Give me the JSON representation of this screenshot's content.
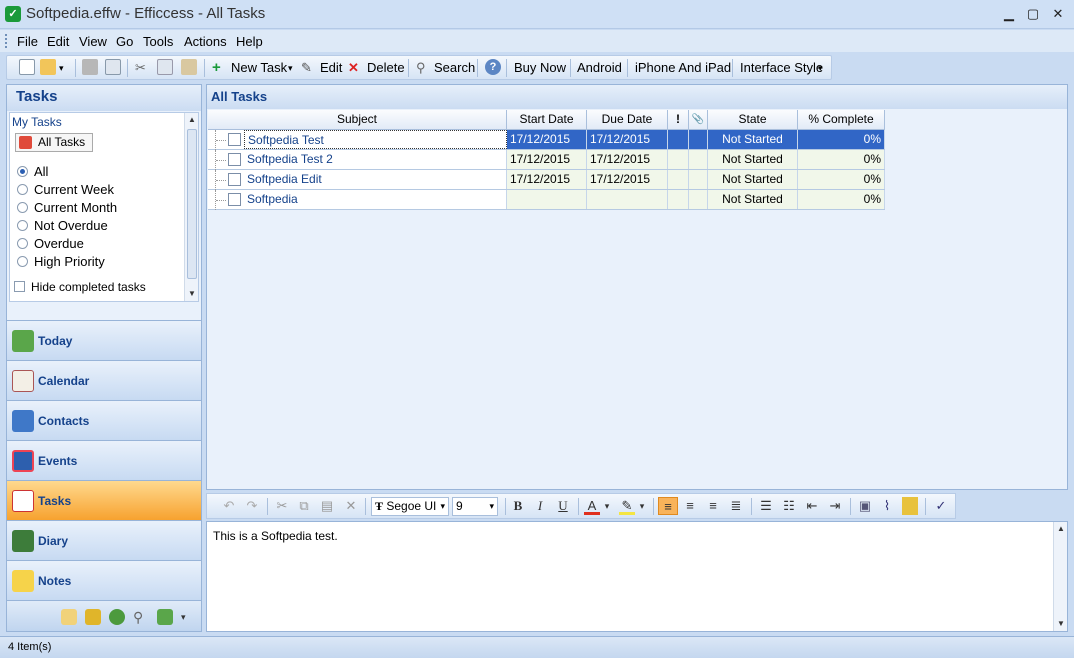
{
  "window": {
    "title": "Softpedia.effw - Efficcess - All Tasks",
    "minimize": "▁",
    "maximize": "▢",
    "close": "✕"
  },
  "menu": [
    "File",
    "Edit",
    "View",
    "Go",
    "Tools",
    "Actions",
    "Help"
  ],
  "toolbar": {
    "new_task": "New Task",
    "edit": "Edit",
    "delete": "Delete",
    "search": "Search",
    "buy_now": "Buy Now",
    "android": "Android",
    "iphone": "iPhone And iPad",
    "interface_style": "Interface Style",
    "dropdown_glyph": "▾"
  },
  "left_panel": {
    "title": "Tasks",
    "subtitle": "My Tasks",
    "all_tasks": "All Tasks",
    "filters": [
      "All",
      "Current Week",
      "Current Month",
      "Not Overdue",
      "Overdue",
      "High Priority"
    ],
    "selected_filter": "All",
    "hide_completed": "Hide completed tasks",
    "nav": [
      "Today",
      "Calendar",
      "Contacts",
      "Events",
      "Tasks",
      "Diary",
      "Notes"
    ],
    "active_nav": "Tasks"
  },
  "main": {
    "title": "All Tasks",
    "columns": [
      "Subject",
      "Start Date",
      "Due Date",
      "!",
      "📎",
      "State",
      "% Complete"
    ],
    "rows": [
      {
        "subject": "Softpedia Test",
        "start": "17/12/2015",
        "due": "17/12/2015",
        "state": "Not Started",
        "complete": "0%"
      },
      {
        "subject": "Softpedia Test 2",
        "start": "17/12/2015",
        "due": "17/12/2015",
        "state": "Not Started",
        "complete": "0%"
      },
      {
        "subject": "Softpedia Edit",
        "start": "17/12/2015",
        "due": "17/12/2015",
        "state": "Not Started",
        "complete": "0%"
      },
      {
        "subject": "Softpedia",
        "start": "",
        "due": "",
        "state": "Not Started",
        "complete": "0%"
      }
    ]
  },
  "editor": {
    "font": "Segoe UI",
    "size": "9",
    "bold": "B",
    "italic": "I",
    "underline": "U",
    "content": "This is a Softpedia test."
  },
  "status": {
    "items": "4 Item(s)"
  },
  "colors": {
    "accent": "#15428b",
    "selection": "#3166c6",
    "active_nav": "#f7a22f"
  }
}
